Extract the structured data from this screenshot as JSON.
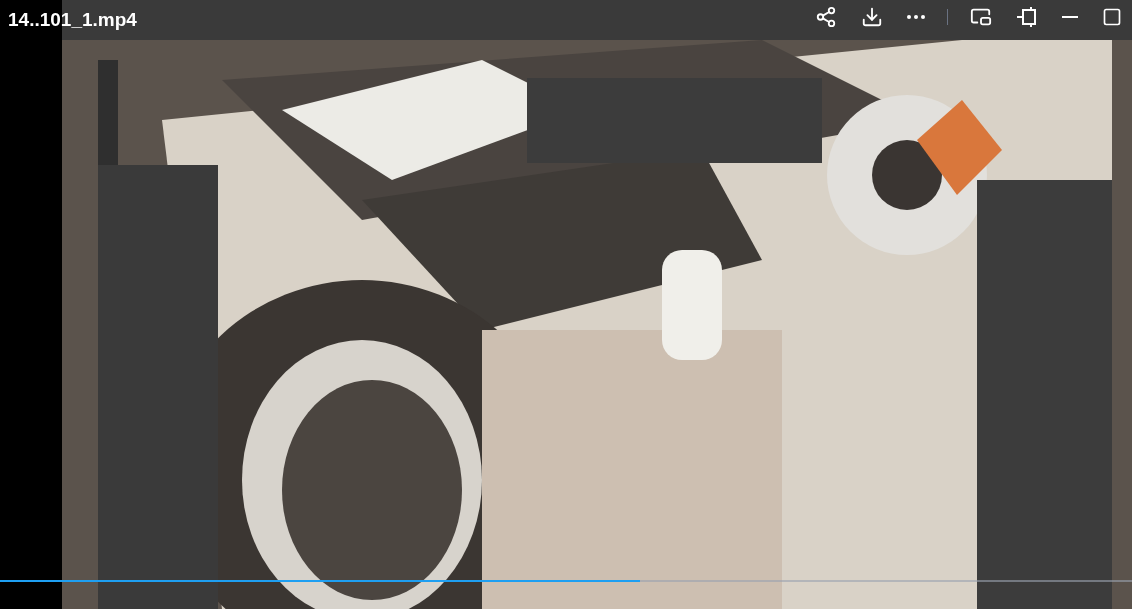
{
  "video": {
    "title": "14..101_1.mp4"
  },
  "progress": {
    "level": 0.565
  }
}
